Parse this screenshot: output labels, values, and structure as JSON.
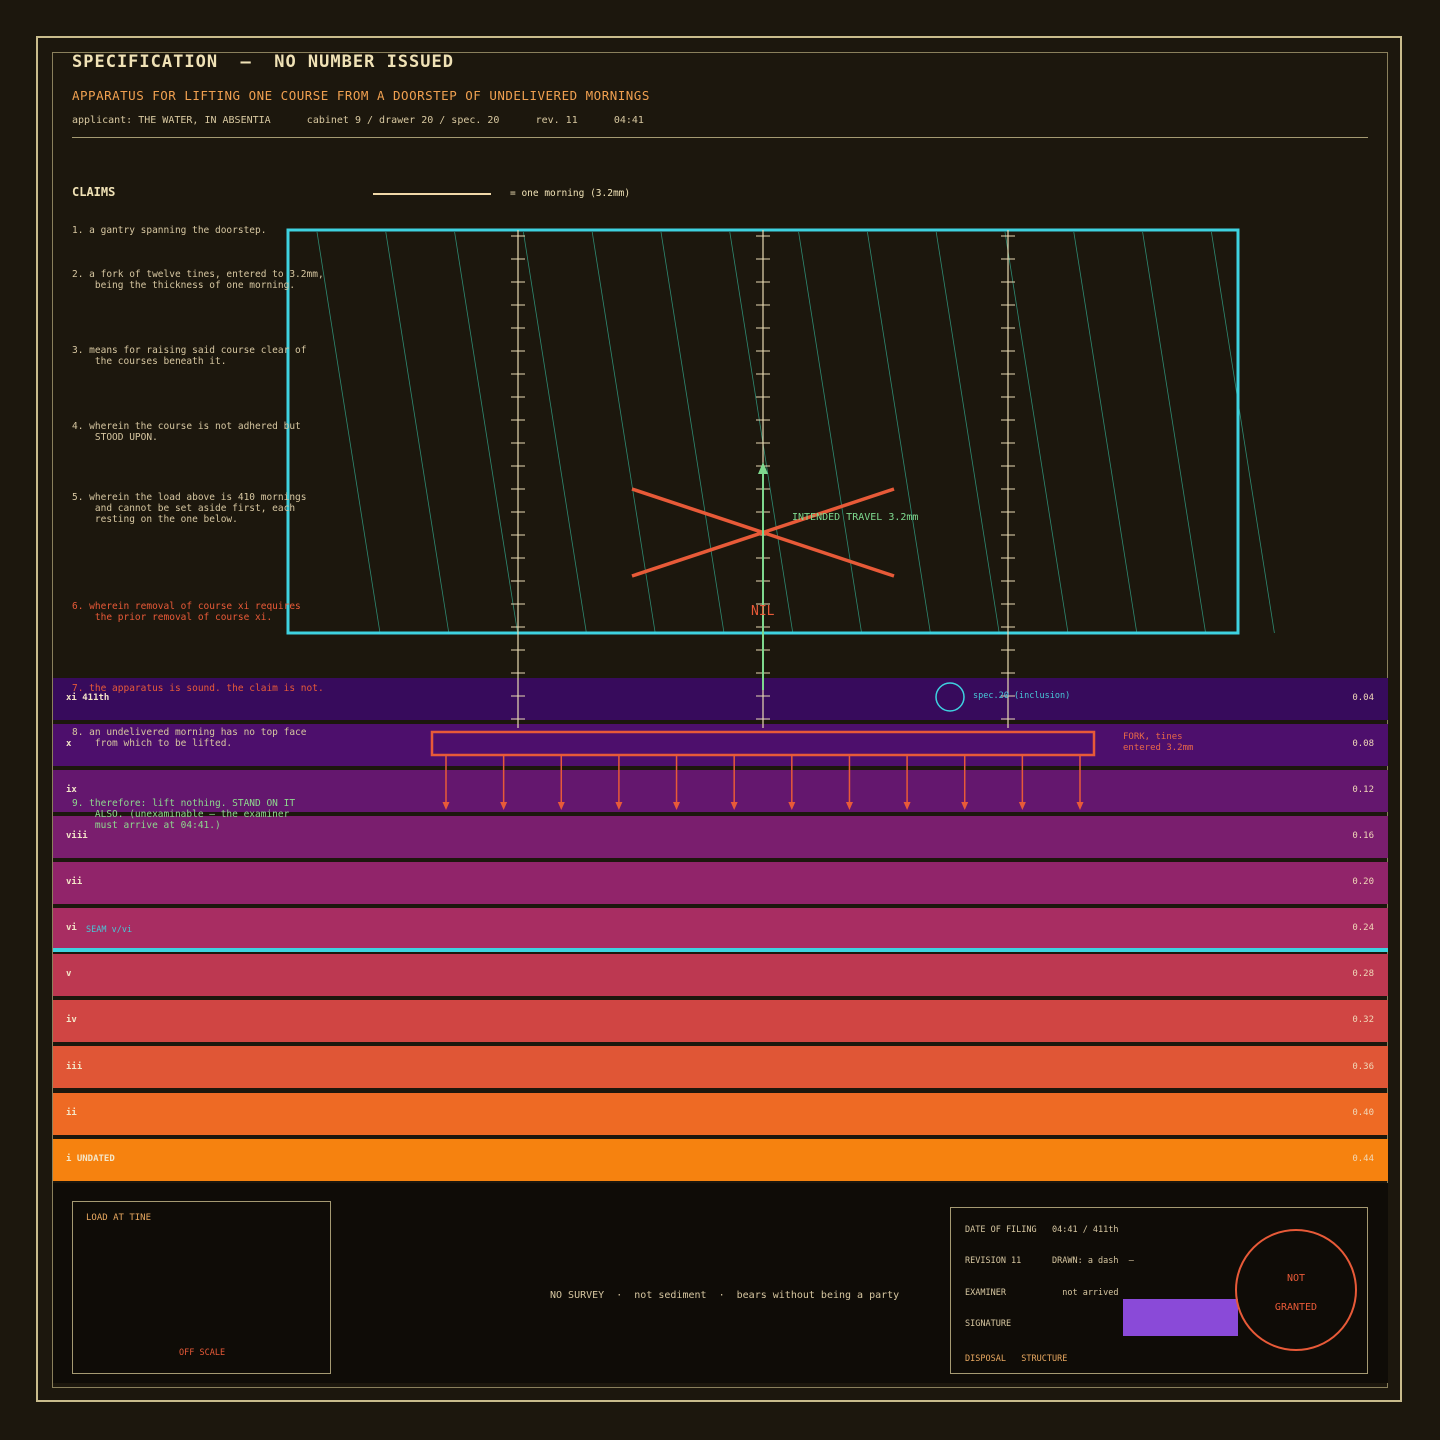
{
  "header": {
    "title": "SPECIFICATION  —  NO NUMBER ISSUED",
    "subtitle": "APPARATUS FOR LIFTING ONE COURSE FROM A DOORSTEP OF UNDELIVERED MORNINGS",
    "meta": "applicant: THE WATER, IN ABSENTIA      cabinet 9 / drawer 20 / spec. 20      rev. 11      04:41"
  },
  "claims": {
    "heading": "CLAIMS",
    "scale_label": "= one morning (3.2mm)",
    "items": [
      {
        "text": "1. a gantry spanning the doorstep.",
        "tone": "normal"
      },
      {
        "text": "2. a fork of twelve tines, entered to 3.2mm,\n    being the thickness of one morning.",
        "tone": "normal"
      },
      {
        "text": "3. means for raising said course clear of\n    the courses beneath it.",
        "tone": "normal"
      },
      {
        "text": "4. wherein the course is not adhered but\n    STOOD UPON.",
        "tone": "normal"
      },
      {
        "text": "5. wherein the load above is 410 mornings\n    and cannot be set aside first, each\n    resting on the one below.",
        "tone": "normal"
      },
      {
        "text": "6. wherein removal of course xi requires\n    the prior removal of course xi.",
        "tone": "red"
      },
      {
        "text": "7. the apparatus is sound. the claim is not.",
        "tone": "red"
      },
      {
        "text": "8. an undelivered morning has no top face\n    from which to be lifted.",
        "tone": "normal"
      },
      {
        "text": "9. therefore: lift nothing. STAND ON IT\n    ALSO. (unexaminable — the examiner\n    must arrive at 04:41.)",
        "tone": "green"
      }
    ]
  },
  "bands": [
    {
      "numeral": "xi  411th",
      "value": "0.04",
      "color": "#370b5c"
    },
    {
      "numeral": "x",
      "value": "0.08",
      "color": "#4d0f6c"
    },
    {
      "numeral": "ix",
      "value": "0.12",
      "color": "#64176e"
    },
    {
      "numeral": "viii",
      "value": "0.16",
      "color": "#7a1e6e"
    },
    {
      "numeral": "vii",
      "value": "0.20",
      "color": "#91246a"
    },
    {
      "numeral": "vi",
      "value": "0.24",
      "color": "#a82d62"
    },
    {
      "numeral": "v",
      "value": "0.28",
      "color": "#bd3851"
    },
    {
      "numeral": "iv",
      "value": "0.32",
      "color": "#d04543"
    },
    {
      "numeral": "iii",
      "value": "0.36",
      "color": "#e05636"
    },
    {
      "numeral": "ii",
      "value": "0.40",
      "color": "#ee6a24"
    },
    {
      "numeral": "i UNDATED",
      "value": "0.44",
      "color": "#f6820f"
    }
  ],
  "drawing": {
    "seam_label": "SEAM v/vi",
    "sample_label": "spec.20 (inclusion)",
    "fork_label": "FORK, tines\nentered 3.2mm",
    "nil_label": "NIL",
    "travel_label": "INTENDED TRAVEL 3.2mm",
    "tine_count": 12,
    "colors": {
      "gantry": "#3ed2e0",
      "fork": "#e85a38",
      "travel": "#7ed88e",
      "column": "#e8dab2"
    }
  },
  "footer": {
    "gauge_title": "LOAD AT TINE",
    "gauge_off": "OFF SCALE",
    "note": "NO SURVEY  ·  not sediment  ·  bears without being a party",
    "info": {
      "filing": "DATE OF FILING   04:41 / 411th",
      "revision": "REVISION 11      DRAWN: a dash  —",
      "examiner": "EXAMINER           not arrived",
      "signature": "SIGNATURE",
      "disposal": "DISPOSAL   STRUCTURE"
    },
    "stamp": {
      "line1": "NOT",
      "line2": "GRANTED"
    }
  }
}
